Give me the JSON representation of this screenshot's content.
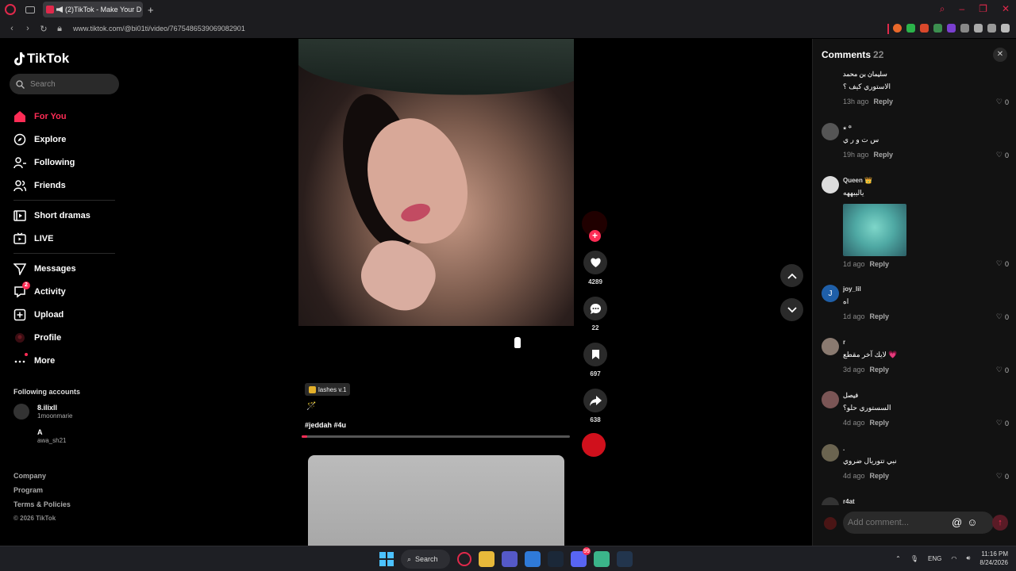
{
  "browser": {
    "tab_title": "(2)TikTok - Make Your D",
    "new_tab": "+",
    "url": "www.tiktok.com/@bi01ti/video/7675486539069082901"
  },
  "sidebar": {
    "logo_text": "TikTok",
    "search_placeholder": "Search",
    "nav": [
      {
        "label": "For You",
        "icon": "home-icon",
        "active": true
      },
      {
        "label": "Explore",
        "icon": "compass-icon"
      },
      {
        "label": "Following",
        "icon": "user-follow-icon"
      },
      {
        "label": "Friends",
        "icon": "friends-icon"
      },
      {
        "label": "Short dramas",
        "icon": "film-icon"
      },
      {
        "label": "LIVE",
        "icon": "tv-icon"
      },
      {
        "label": "Messages",
        "icon": "send-icon"
      },
      {
        "label": "Activity",
        "icon": "activity-icon",
        "badge": "2"
      },
      {
        "label": "Upload",
        "icon": "plus-square-icon"
      },
      {
        "label": "Profile",
        "icon": "avatar-icon"
      },
      {
        "label": "More",
        "icon": "more-icon"
      }
    ],
    "following_title": "Following accounts",
    "following": [
      {
        "name": "8.ilixll",
        "handle": "1moonmarie"
      },
      {
        "name": "A",
        "handle": "awa_sh21"
      }
    ],
    "footer": [
      "Company",
      "Program",
      "Terms & Policies"
    ],
    "copyright": "© 2026 TikTok"
  },
  "video": {
    "effect": "lashes v.1",
    "caption_emoji": "🪄",
    "hashtags": "#jeddah #4u",
    "progress": 0.02
  },
  "actions": {
    "likes": "4289",
    "comments": "22",
    "saves": "697",
    "shares": "638"
  },
  "comments_panel": {
    "title": "Comments",
    "count": "22",
    "reply_label": "Reply",
    "items": [
      {
        "user": "سليمان بن محمد",
        "text": "الاستوري كيف ؟",
        "time": "13h ago",
        "likes": "0"
      },
      {
        "user": "٭ ꙳",
        "text": "س ت و ر ي",
        "time": "19h ago",
        "likes": "0"
      },
      {
        "user": "Queen 👑",
        "text": "ياليبههه",
        "time": "1d ago",
        "likes": "0",
        "sticker": true
      },
      {
        "user": "joy_lil",
        "text": "اه",
        "time": "1d ago",
        "likes": "0",
        "initial": "J"
      },
      {
        "user": "r",
        "text": "لايك آخر مقطع 💗",
        "time": "3d ago",
        "likes": "0"
      },
      {
        "user": "فيصل",
        "text": "السستوري حلو؟",
        "time": "4d ago",
        "likes": "0"
      },
      {
        "user": ".",
        "text": "نبي تتوريال ضروي",
        "time": "4d ago",
        "likes": "0"
      },
      {
        "user": "r4at",
        "text": "",
        "time": "",
        "likes": ""
      }
    ],
    "input_placeholder": "Add comment..."
  },
  "taskbar": {
    "search_label": "Search",
    "lang": "ENG",
    "time": "11:16 PM",
    "date": "8/24/2026",
    "discord_badge": "99"
  }
}
